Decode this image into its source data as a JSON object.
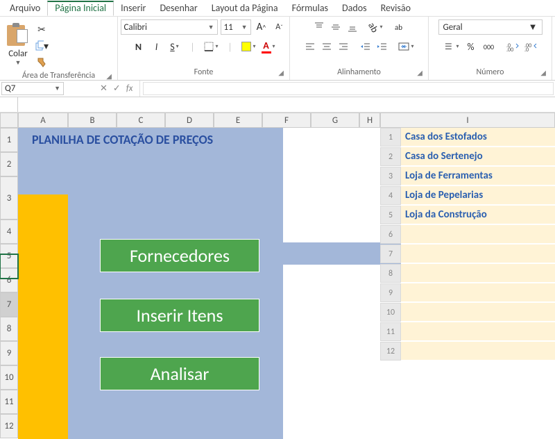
{
  "menu": {
    "items": [
      "Arquivo",
      "Página Inicial",
      "Inserir",
      "Desenhar",
      "Layout da Página",
      "Fórmulas",
      "Dados",
      "Revisão"
    ],
    "active_index": 1
  },
  "ribbon": {
    "clipboard": {
      "paste_label": "Colar",
      "group_label": "Área de Transferência"
    },
    "font": {
      "font_name": "Calibri",
      "font_size": "11",
      "group_label": "Fonte",
      "bold": "N",
      "italic": "I",
      "underline": "S",
      "increase": "A",
      "decrease": "A"
    },
    "alignment": {
      "group_label": "Alinhamento",
      "wrap": "ab"
    },
    "number": {
      "group_label": "Número",
      "format": "Geral",
      "percent": "%",
      "comma": "000"
    }
  },
  "formula_bar": {
    "cell_ref": "Q7",
    "fx": "fx"
  },
  "columns": [
    "A",
    "B",
    "C",
    "D",
    "E",
    "F",
    "G",
    "H",
    "I"
  ],
  "rows": [
    "1",
    "2",
    "3",
    "4",
    "5",
    "6",
    "7",
    "8",
    "9",
    "10",
    "11",
    "12"
  ],
  "sheet": {
    "title": "PLANILHA DE COTAÇÃO DE PREÇOS",
    "buttons": [
      "Fornecedores",
      "Inserir Itens",
      "Analisar"
    ],
    "h_numbers": [
      "1",
      "2",
      "3",
      "4",
      "5",
      "6",
      "7",
      "8",
      "9",
      "10",
      "11",
      "12"
    ],
    "suppliers": [
      "Casa dos Estofados",
      "Casa do Sertenejo",
      "Loja de Ferramentas",
      "Loja de Pepelarias",
      "Loja da Construção"
    ]
  }
}
